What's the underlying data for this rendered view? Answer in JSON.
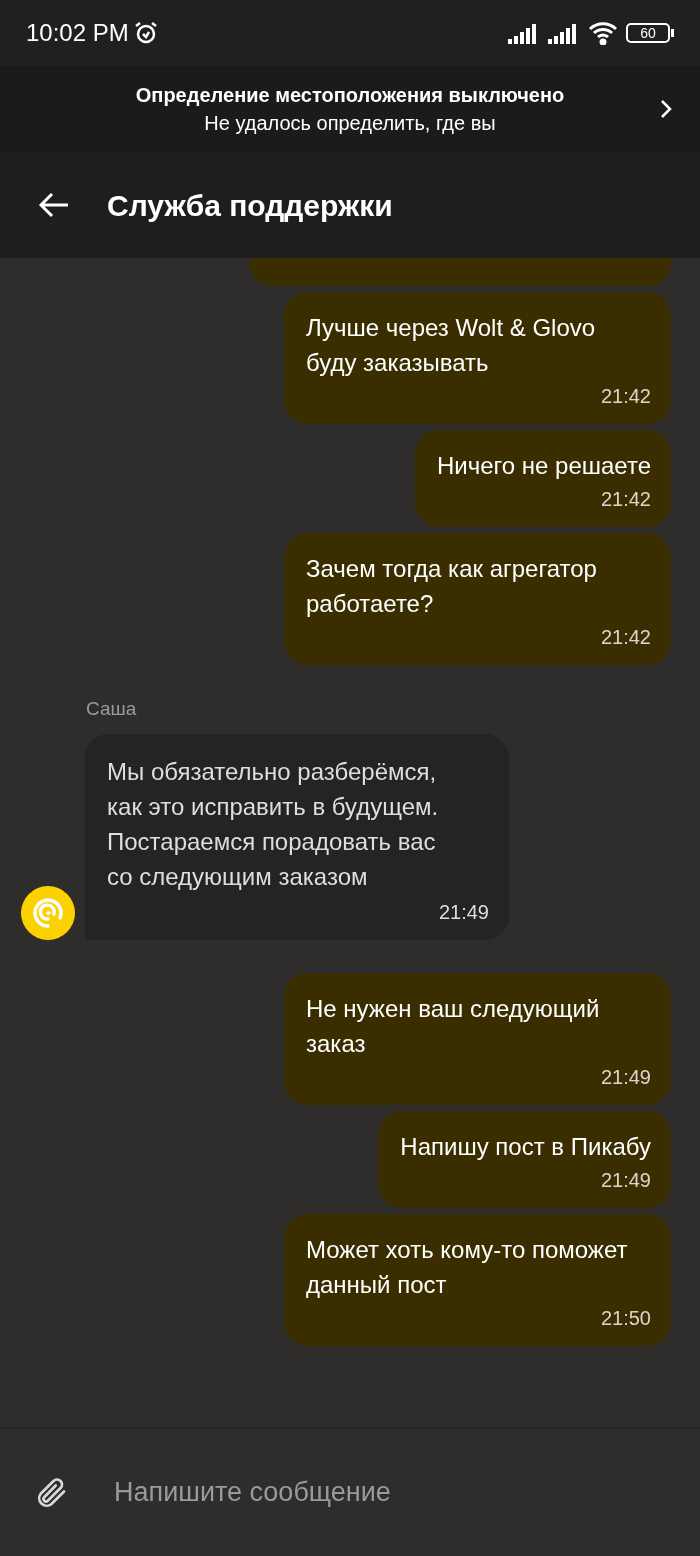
{
  "status_bar": {
    "time": "10:02 PM",
    "battery": "60"
  },
  "location_banner": {
    "title": "Определение местоположения выключено",
    "subtitle": "Не удалось определить, где вы"
  },
  "header": {
    "title": "Служба поддержки"
  },
  "messages": [
    {
      "kind": "out",
      "text": "Лучше через Wolt & Glovo буду заказывать",
      "time": "21:42"
    },
    {
      "kind": "out",
      "text": "Ничего не решаете",
      "time": "21:42"
    },
    {
      "kind": "out",
      "text": "Зачем тогда как агрегатор работаете?",
      "time": "21:42"
    },
    {
      "kind": "in",
      "sender": "Саша",
      "text": "Мы обязательно разберёмся, как это исправить в будущем. Постараемся порадовать вас со следующим заказом",
      "time": "21:49"
    },
    {
      "kind": "out",
      "text": "Не нужен ваш следующий заказ",
      "time": "21:49"
    },
    {
      "kind": "out",
      "text": "Напишу пост в Пикабу",
      "time": "21:49"
    },
    {
      "kind": "out",
      "text": "Может хоть кому-то поможет данный пост",
      "time": "21:50"
    }
  ],
  "composer": {
    "placeholder": "Напишите сообщение"
  }
}
